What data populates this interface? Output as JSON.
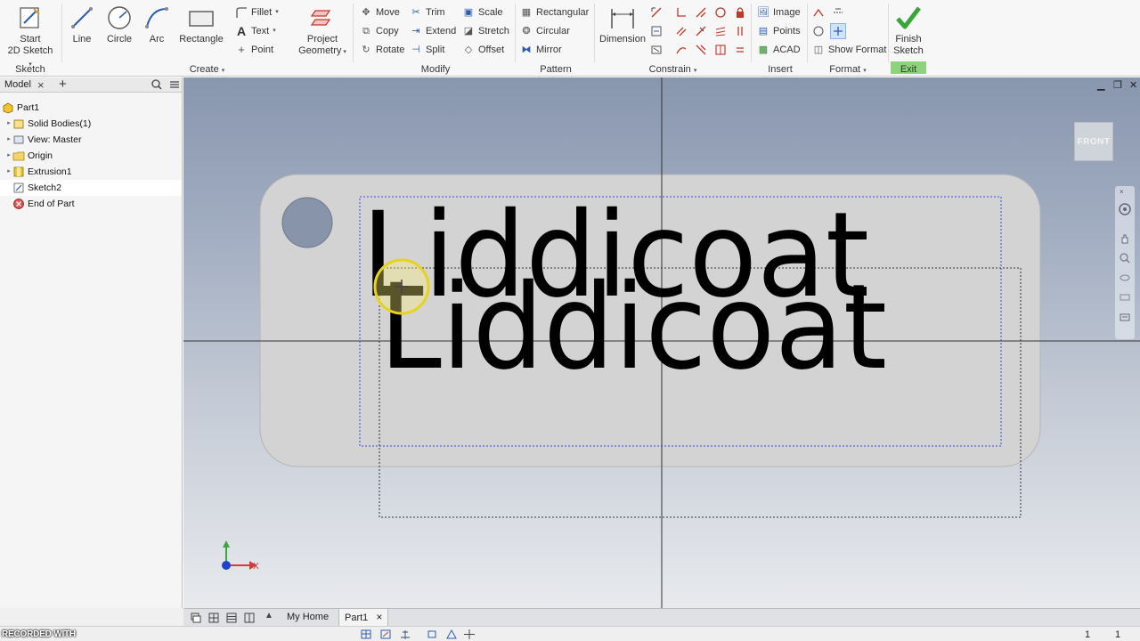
{
  "ribbon": {
    "sketch_group": {
      "title": "Sketch",
      "start_label_1": "Start",
      "start_label_2": "2D Sketch"
    },
    "create_group": {
      "title": "Create",
      "line": "Line",
      "circle": "Circle",
      "arc": "Arc",
      "rectangle": "Rectangle",
      "fillet": "Fillet",
      "text": "Text",
      "point": "Point",
      "project_1": "Project",
      "project_2": "Geometry"
    },
    "modify_group": {
      "title": "Modify",
      "move": "Move",
      "trim": "Trim",
      "scale": "Scale",
      "copy": "Copy",
      "extend": "Extend",
      "stretch": "Stretch",
      "rotate": "Rotate",
      "split": "Split",
      "offset": "Offset"
    },
    "pattern_group": {
      "title": "Pattern",
      "rectangular": "Rectangular",
      "circular": "Circular",
      "mirror": "Mirror"
    },
    "constrain_group": {
      "title": "Constrain",
      "dimension": "Dimension"
    },
    "insert_group": {
      "title": "Insert",
      "image": "Image",
      "points": "Points",
      "acad": "ACAD"
    },
    "format_group": {
      "title": "Format",
      "show_format": "Show Format"
    },
    "exit_group": {
      "title": "Exit",
      "finish_1": "Finish",
      "finish_2": "Sketch"
    }
  },
  "browser": {
    "tab_label": "Model",
    "tree": [
      {
        "label": "Part1"
      },
      {
        "label": "Solid Bodies(1)"
      },
      {
        "label": "View: Master"
      },
      {
        "label": "Origin"
      },
      {
        "label": "Extrusion1"
      },
      {
        "label": "Sketch2"
      },
      {
        "label": "End of Part"
      }
    ]
  },
  "viewport": {
    "text_top": "Liddicoat",
    "text_bottom": "Liddicoat",
    "viewcube_label": "FRONT",
    "axis_x_label": "X"
  },
  "doc_tabs": {
    "home": "My Home",
    "part": "Part1"
  },
  "status": {
    "recorded": "RECORDED WITH",
    "count_1": "1",
    "count_2": "1"
  },
  "colors": {
    "exit_accent": "#8fd27d",
    "sketch_dash": "#3a48d8",
    "viewport_top": "#8896ae"
  }
}
